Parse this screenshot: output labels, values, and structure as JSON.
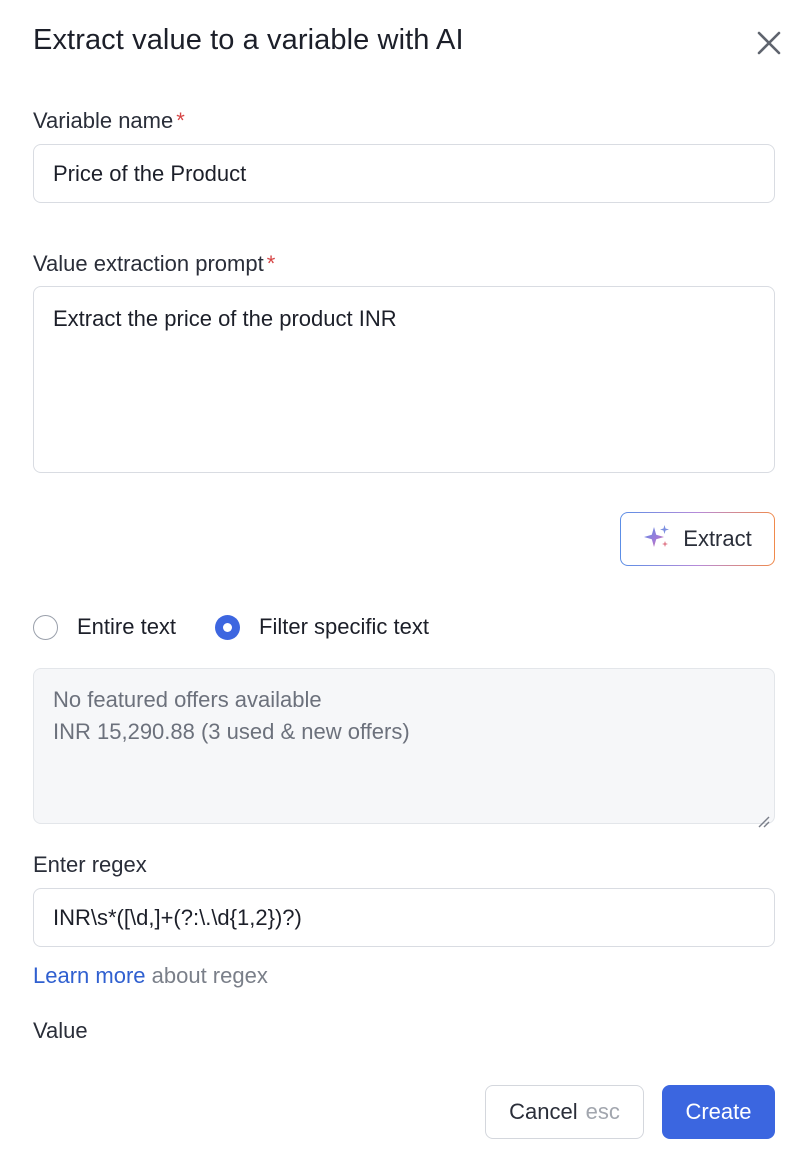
{
  "dialog": {
    "title": "Extract value to a variable with AI",
    "close_icon": "close-icon"
  },
  "variable_name": {
    "label": "Variable name",
    "required_mark": "*",
    "value": "Price of the Product"
  },
  "prompt": {
    "label": "Value extraction prompt",
    "required_mark": "*",
    "value": "Extract the price of the product INR"
  },
  "extract_button": {
    "label": "Extract",
    "icon": "sparkle-icon"
  },
  "mode": {
    "options": [
      {
        "label": "Entire text",
        "selected": false
      },
      {
        "label": "Filter specific text",
        "selected": true
      }
    ]
  },
  "filtered_text": {
    "lines": [
      "No featured offers available",
      "INR 15,290.88 (3 used & new offers)"
    ]
  },
  "regex": {
    "label": "Enter regex",
    "value": "INR\\s*([\\d,]+(?:\\.\\d{1,2})?)",
    "learn_more_link": "Learn more",
    "learn_more_suffix": " about regex"
  },
  "value_section": {
    "label": "Value"
  },
  "footer": {
    "cancel_label": "Cancel",
    "cancel_shortcut": "esc",
    "create_label": "Create"
  },
  "colors": {
    "primary": "#3b66e0",
    "required": "#d64545",
    "link": "#3060d0"
  }
}
